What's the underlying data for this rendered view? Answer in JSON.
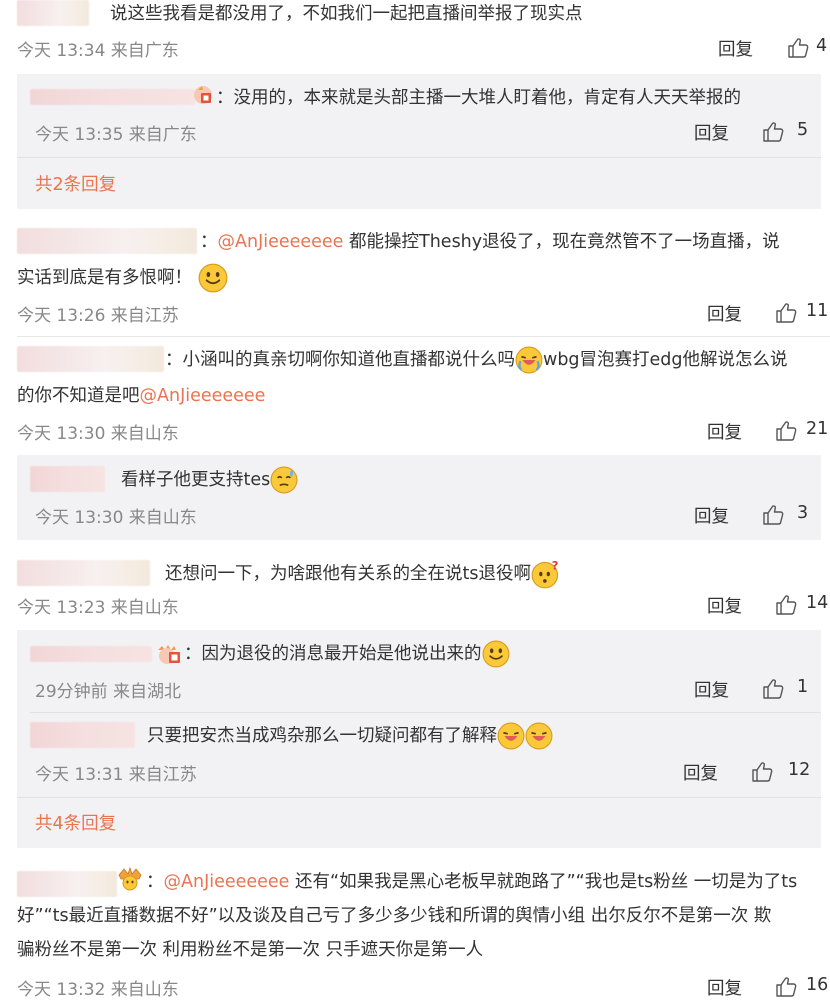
{
  "c1": {
    "text": "说这些我看是都没用了，不如我们一起把直播间举报了现实点",
    "meta": "今天 13:34 来自广东",
    "reply": "回复",
    "likes": "4"
  },
  "r1": {
    "text": "：没用的，本来就是头部主播一大堆人盯着他，肯定有人天天举报的",
    "meta": "今天 13:35 来自广东",
    "reply": "回复",
    "likes": "5",
    "expand": "共2条回复"
  },
  "c2": {
    "sep": "：",
    "mention": "@AnJieeeeeee",
    "text1": " 都能操控Theshy退役了，现在竟然管不了一场直播，说",
    "text2": "实话到底是有多恨啊！",
    "meta": "今天 13:26 来自江苏",
    "reply": "回复",
    "likes": "11"
  },
  "c3": {
    "text1": "：小涵叫的真亲切啊你知道他直播都说什么吗",
    "text1b": "wbg冒泡赛打edg他解说怎么说",
    "text2": "的你不知道是吧",
    "mention": "@AnJieeeeeee",
    "meta": "今天 13:30 来自山东",
    "reply": "回复",
    "likes": "21"
  },
  "r3": {
    "text": "看样子他更支持tes",
    "meta": "今天 13:30 来自山东",
    "reply": "回复",
    "likes": "3"
  },
  "c4": {
    "text": "还想问一下，为啥跟他有关系的全在说ts退役啊",
    "meta": "今天 13:23 来自山东",
    "reply": "回复",
    "likes": "14"
  },
  "r4a": {
    "text": "：因为退役的消息最开始是他说出来的",
    "meta": "29分钟前 来自湖北",
    "reply": "回复",
    "likes": "1"
  },
  "r4b": {
    "text": "只要把安杰当成鸡杂那么一切疑问都有了解释",
    "meta": "今天 13:31 来自江苏",
    "reply": "回复",
    "likes": "12",
    "expand": "共4条回复"
  },
  "c5": {
    "sep": "：",
    "mention": "@AnJieeeeeee",
    "text1": " 还有“如果我是黑心老板早就跑路了”“我也是ts粉丝 一切是为了ts",
    "text2": "好”“ts最近直播数据不好”以及谈及自己亏了多少多少钱和所谓的舆情小组 出尔反尔不是第一次 欺",
    "text3": "骗粉丝不是第一次 利用粉丝不是第一次 只手遮天你是第一人",
    "meta": "今天 13:32 来自山东",
    "reply": "回复",
    "likes": "16"
  },
  "icons": [
    "like-icon",
    "smile-emoji",
    "crying-hug-emoji",
    "sweat-emoji",
    "question-emoji",
    "crown-badge-icon",
    "fan-badge-icon"
  ]
}
